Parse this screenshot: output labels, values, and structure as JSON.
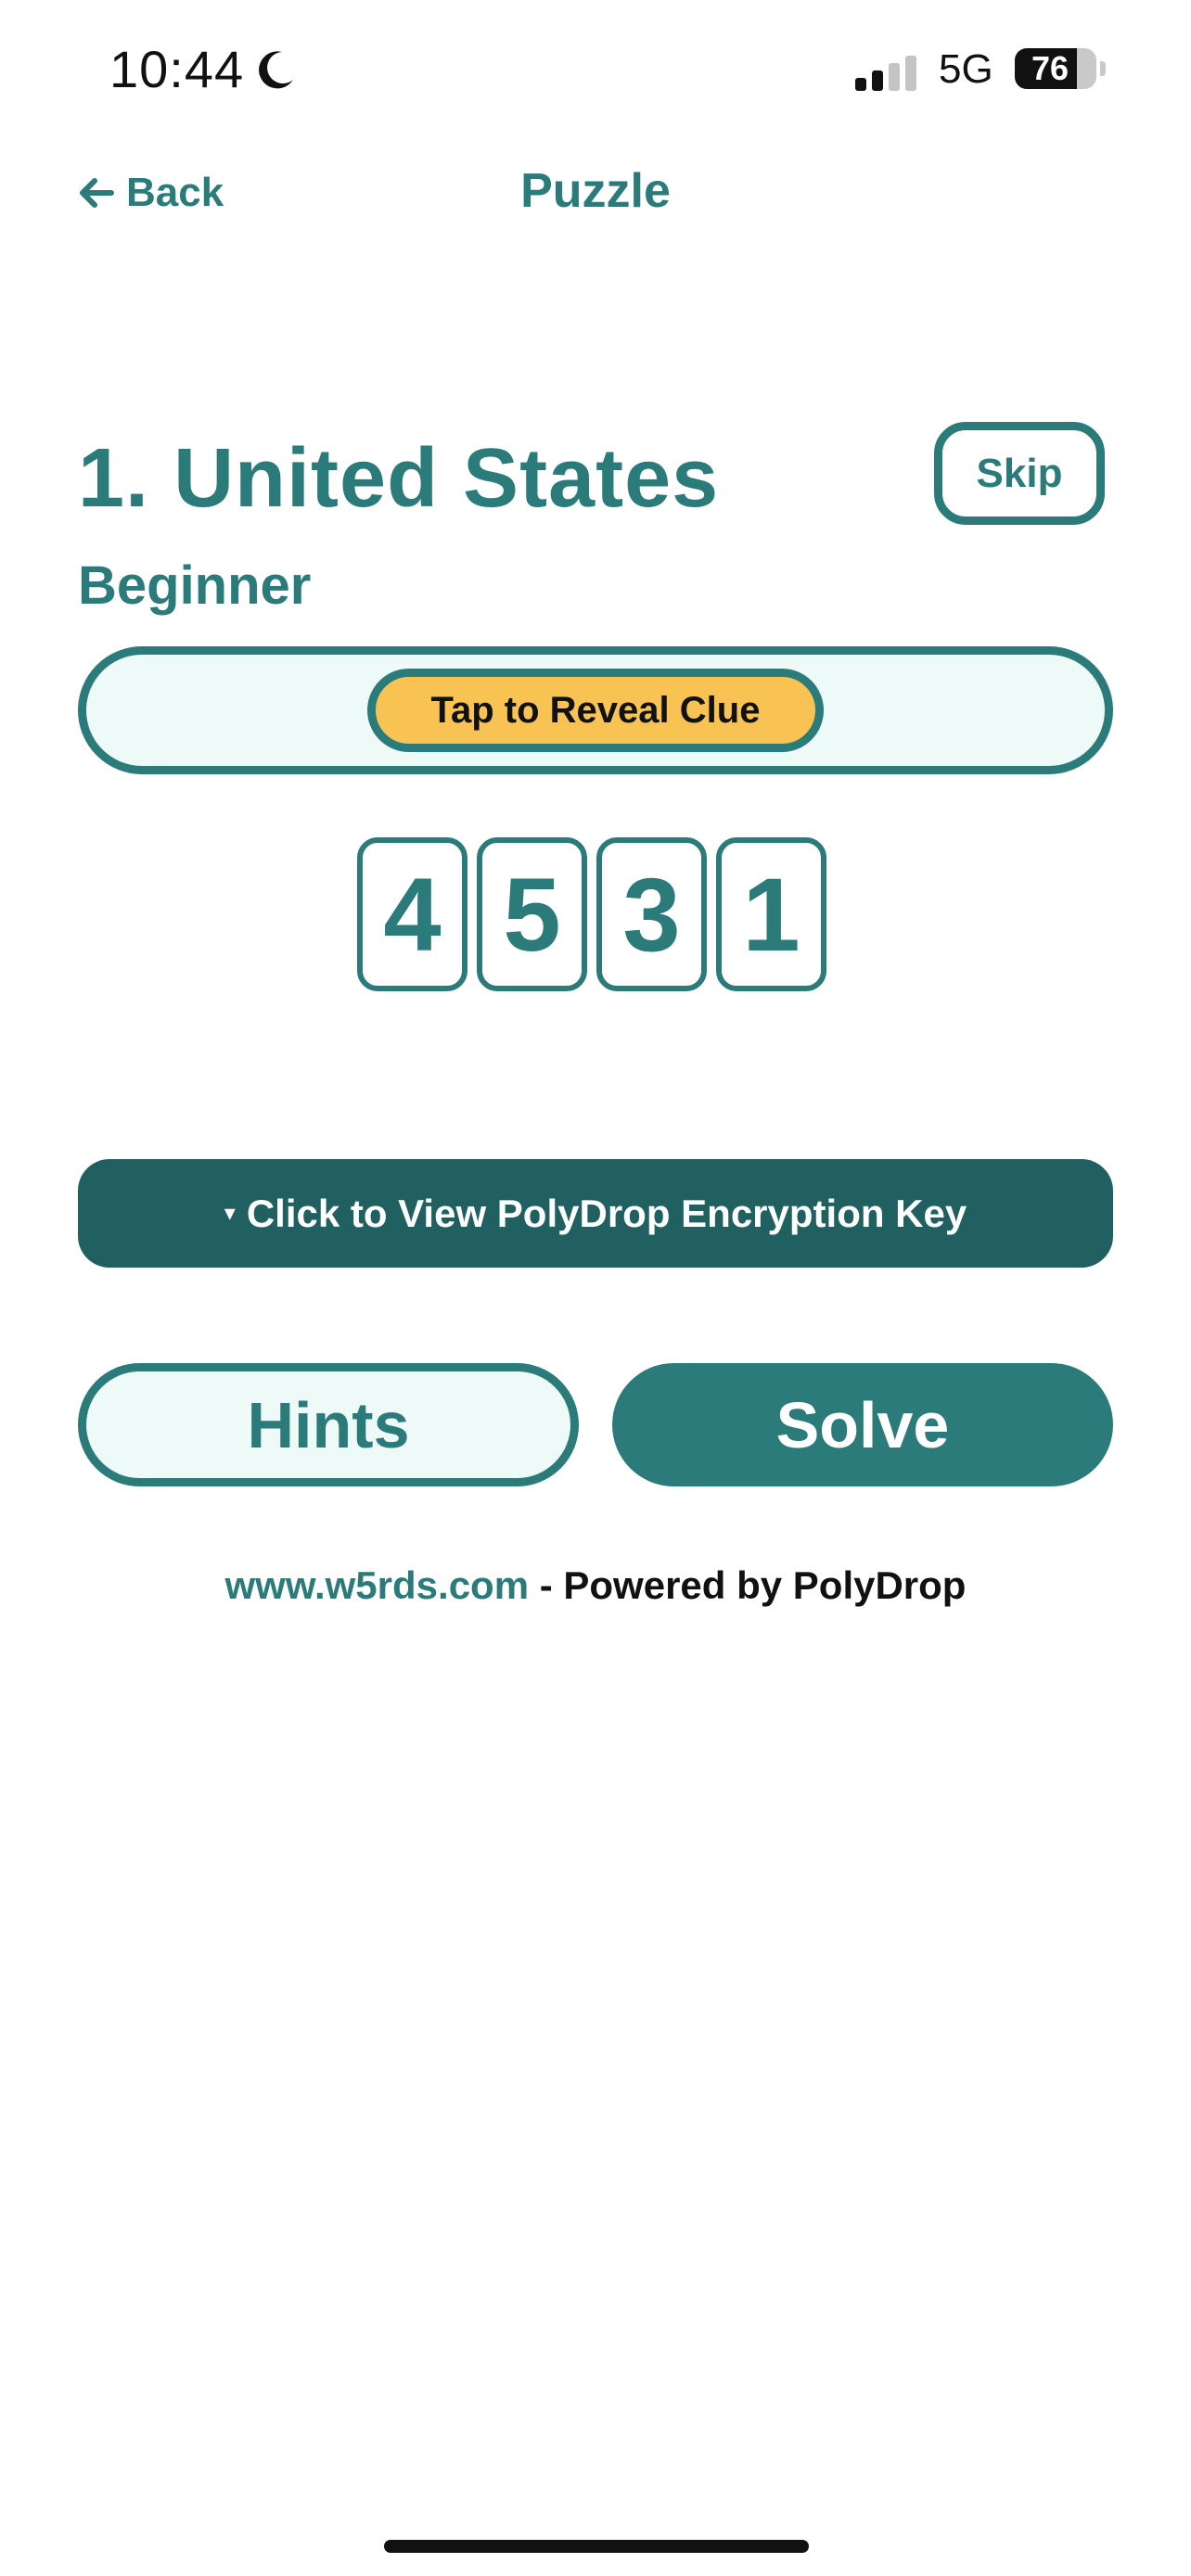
{
  "status_bar": {
    "time": "10:44",
    "network": "5G",
    "battery": "76",
    "battery_level": 0.76,
    "signal_bars_active": 2,
    "signal_bars_total": 4
  },
  "nav": {
    "back_label": "Back",
    "title": "Puzzle"
  },
  "puzzle": {
    "title": "1. United States",
    "skip_label": "Skip",
    "difficulty": "Beginner",
    "clue_button_label": "Tap to Reveal Clue",
    "digits": [
      "4",
      "5",
      "3",
      "1"
    ]
  },
  "encryption_key": {
    "indicator": "▾",
    "label": "Click to View PolyDrop Encryption Key"
  },
  "actions": {
    "hints_label": "Hints",
    "solve_label": "Solve"
  },
  "footer": {
    "link_text": "www.w5rds.com",
    "suffix_text": " - Powered by PolyDrop"
  },
  "colors": {
    "primary": "#2a7b7a",
    "primary_dark": "#216061",
    "accent": "#f9c353",
    "light_bg": "#eefaf7"
  },
  "icons": {
    "moon": "moon-icon",
    "back": "arrow-left-icon",
    "signal": "signal-icon",
    "battery": "battery-icon"
  }
}
